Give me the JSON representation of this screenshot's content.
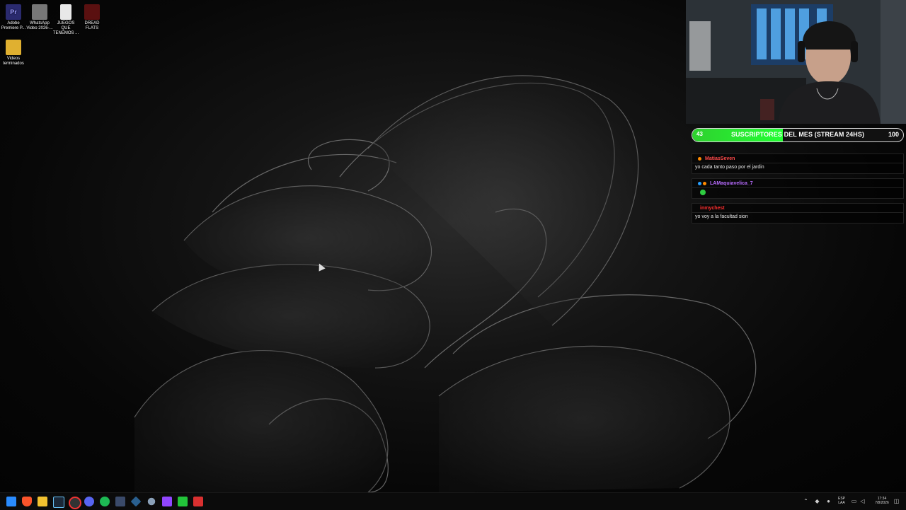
{
  "desktop": {
    "icons": [
      {
        "label": "Adobe\nPremiere P...",
        "color": "#2a2a6e",
        "glyph": "Pr",
        "icon": "premiere-icon"
      },
      {
        "label": "WhatsApp\nVideo 2026-...",
        "color": "#777777",
        "glyph": "",
        "icon": "video-file-icon"
      },
      {
        "label": "JUEGOS QUE\nTENEMOS ...",
        "color": "#e8e8e8",
        "glyph": "",
        "icon": "text-file-icon"
      },
      {
        "label": "DREAD\nFLATS",
        "color": "#5a1010",
        "glyph": "",
        "icon": "game-icon"
      },
      {
        "label": "Videos\nterminados",
        "color": "#e0b030",
        "glyph": "",
        "icon": "folder-icon"
      }
    ]
  },
  "overlay": {
    "subs_count": "43",
    "subs_title": "SUSCRIPTORES DEL MES (STREAM 24HS)",
    "subs_goal": "100",
    "subs_progress": 0.43,
    "fill_color": "#22ff33"
  },
  "chat": {
    "cut_line": "",
    "messages": [
      {
        "user": "MatiasSeven",
        "color": "#ff4a4a",
        "text": "yo cada tanto paso por el jardin",
        "emote": false
      },
      {
        "user": "LAMaquiavelica_7",
        "color": "#b86cff",
        "text": "",
        "emote": true
      },
      {
        "user": "inmychest",
        "color": "#ff2e2e",
        "text": "yo voy a la facultad sion",
        "emote": false
      }
    ]
  },
  "taskbar": {
    "icons": [
      "windows-start-icon",
      "brave-icon",
      "file-explorer-icon",
      "steam-icon",
      "chrome-icon",
      "discord-icon",
      "spotify-icon",
      "app-icon",
      "network-icon",
      "settings-icon",
      "twitch-icon",
      "green-app-icon",
      "red-app-icon"
    ],
    "lang_top": "ESP",
    "lang_bottom": "LAA",
    "time": "17:34",
    "date": "7/8/2026"
  }
}
